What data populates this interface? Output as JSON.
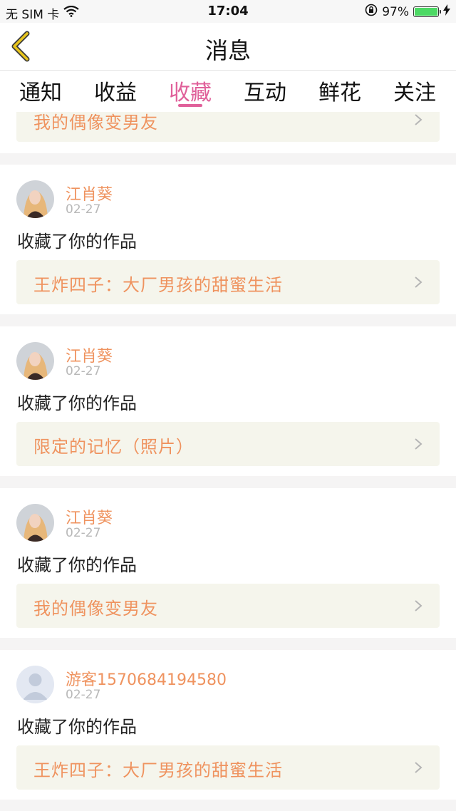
{
  "status_bar": {
    "carrier": "无 SIM 卡",
    "time": "17:04",
    "battery_percent": "97%",
    "battery_level": 0.97,
    "icons": [
      "wifi-icon",
      "orientation-lock-icon",
      "battery-icon",
      "charging-bolt-icon"
    ]
  },
  "nav": {
    "title": "消息",
    "back_icon": "chevron-left-icon",
    "accent_color": "#e0609a"
  },
  "tabs": [
    {
      "label": "通知",
      "active": false
    },
    {
      "label": "收益",
      "active": false
    },
    {
      "label": "收藏",
      "active": true
    },
    {
      "label": "互动",
      "active": false
    },
    {
      "label": "鲜花",
      "active": false
    },
    {
      "label": "关注",
      "active": false
    }
  ],
  "partial_top": {
    "work_title": "我的偶像变男友"
  },
  "items": [
    {
      "user": "江肖葵",
      "time": "02-27",
      "action": "收藏了你的作品",
      "work_title": "王炸四子：大厂男孩的甜蜜生活",
      "avatar": "photo"
    },
    {
      "user": "江肖葵",
      "time": "02-27",
      "action": "收藏了你的作品",
      "work_title": "限定的记忆（照片）",
      "avatar": "photo"
    },
    {
      "user": "江肖葵",
      "time": "02-27",
      "action": "收藏了你的作品",
      "work_title": "我的偶像变男友",
      "avatar": "photo"
    },
    {
      "user": "游客1570684194580",
      "time": "02-27",
      "action": "收藏了你的作品",
      "work_title": "王炸四子：大厂男孩的甜蜜生活",
      "avatar": "default"
    }
  ],
  "colors": {
    "username": "#ef935f",
    "work_bg": "#f5f5ec",
    "divider": "#f5f4f4"
  }
}
